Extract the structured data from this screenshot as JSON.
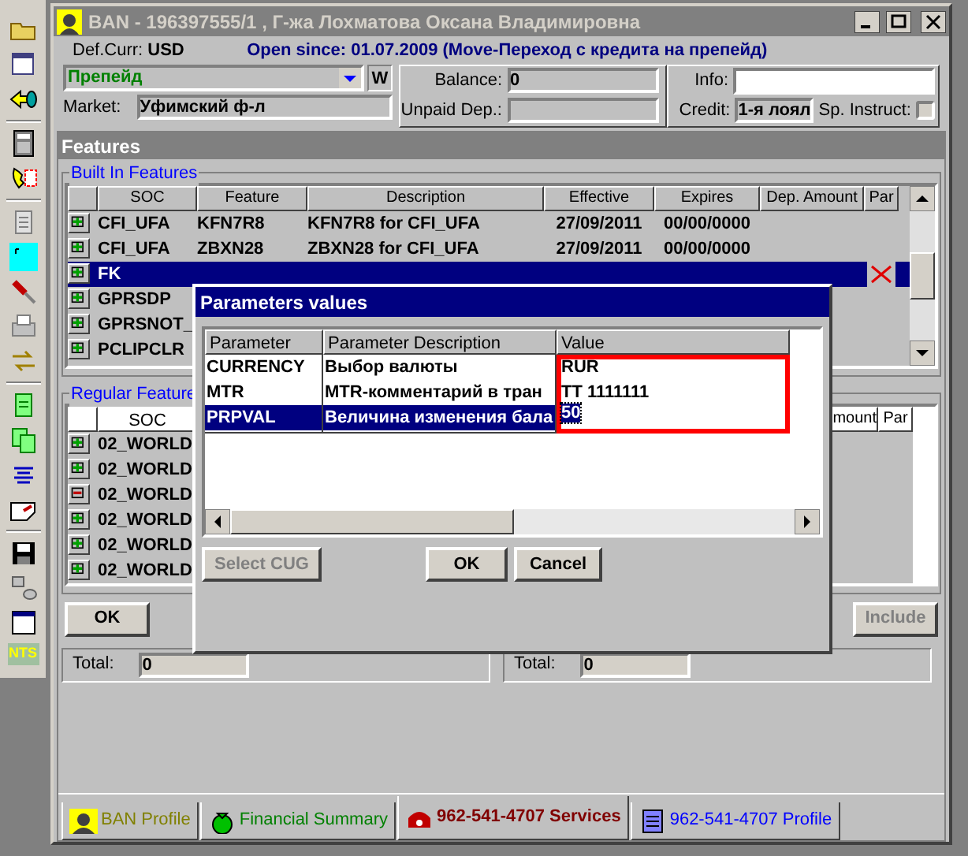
{
  "toolbar": {
    "badge": "NTS"
  },
  "window": {
    "title": "BAN - 196397555/1 , Г-жа Лохматова Оксана Владимировна"
  },
  "header": {
    "def_curr_label": "Def.Curr:",
    "def_curr": "USD",
    "open_since": "Open since: 01.07.2009 (Move-Переход с кредита на препейд)",
    "plan": "Препейд",
    "plan_flag": "W",
    "market_label": "Market:",
    "market": "Уфимский ф-л",
    "balance_label": "Balance:",
    "balance": "0",
    "unpaid_label": "Unpaid Dep.:",
    "info_label": "Info:",
    "credit_label": "Credit:",
    "credit": "1-я лоял",
    "sp_instruct_label": "Sp. Instruct:",
    "sp_instruct_checked": false
  },
  "features_bar": "Features",
  "built_in": {
    "title": "Built In Features",
    "columns": [
      "SOC",
      "Feature",
      "Description",
      "Effective",
      "Expires",
      "Dep. Amount",
      "Par"
    ],
    "rows": [
      {
        "kind": "plus",
        "selected": false,
        "removed": false,
        "cells": [
          "CFI_UFA",
          "KFN7R8",
          "KFN7R8 for CFI_UFA",
          "27/09/2011",
          "00/00/0000"
        ]
      },
      {
        "kind": "plus",
        "selected": false,
        "removed": false,
        "cells": [
          "CFI_UFA",
          "ZBXN28",
          "ZBXN28 for CFI_UFA",
          "27/09/2011",
          "00/00/0000"
        ]
      },
      {
        "kind": "plus",
        "selected": true,
        "removed": true,
        "cells": [
          "FK"
        ]
      },
      {
        "kind": "plus",
        "selected": false,
        "removed": false,
        "cells": [
          "GPRSDP"
        ]
      },
      {
        "kind": "plus",
        "selected": false,
        "removed": false,
        "cells": [
          "GPRSNOT_"
        ]
      },
      {
        "kind": "plus",
        "selected": false,
        "removed": false,
        "cells": [
          "PCLIPCLR"
        ]
      }
    ]
  },
  "regular": {
    "title": "Regular Feature",
    "columns": [
      "SOC",
      "mount",
      "Par"
    ],
    "rows": [
      {
        "kind": "plus",
        "soc": "02_WORLD"
      },
      {
        "kind": "plus",
        "soc": "02_WORLD"
      },
      {
        "kind": "minus",
        "soc": "02_WORLD"
      },
      {
        "kind": "plus",
        "soc": "02_WORLD"
      },
      {
        "kind": "plus",
        "soc": "02_WORLD"
      },
      {
        "kind": "plus",
        "soc": "02_WORLD"
      }
    ]
  },
  "buttons": [
    {
      "label": "OK",
      "disabled": false
    },
    {
      "label": "Include",
      "disabled": true
    }
  ],
  "totals": [
    {
      "label": "Total:",
      "value": "0"
    },
    {
      "label": "Total:",
      "value": "0"
    }
  ],
  "tabs": [
    {
      "label": "BAN Profile",
      "selected": false,
      "color": "#808000"
    },
    {
      "label": "Financial Summary",
      "selected": false,
      "color": "#008000"
    },
    {
      "label": "962-541-4707 Services",
      "selected": true,
      "color": "#800000"
    },
    {
      "label": "962-541-4707 Profile",
      "selected": false,
      "color": "#0000ff"
    }
  ],
  "dialog": {
    "title": "Parameters values",
    "columns": [
      "Parameter",
      "Parameter Description",
      "Value"
    ],
    "rows": [
      {
        "parameter": "CURRENCY",
        "description": "Выбор валюты",
        "value": "RUR",
        "selected": false
      },
      {
        "parameter": "MTR",
        "description": "MTR-комментарий в тран",
        "value": "TT 1111111",
        "selected": false
      },
      {
        "parameter": "PRPVAL",
        "description": "Величина изменения бала",
        "value": "50",
        "selected": true
      }
    ],
    "buttons": [
      {
        "label": "Select CUG",
        "disabled": true
      },
      {
        "label": "OK",
        "disabled": false
      },
      {
        "label": "Cancel",
        "disabled": false
      }
    ]
  }
}
